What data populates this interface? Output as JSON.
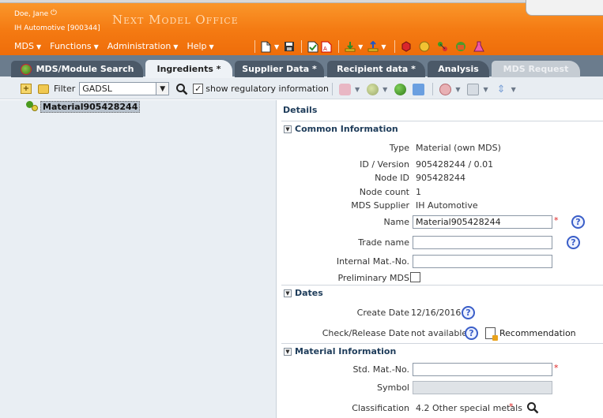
{
  "header": {
    "user_name": "Doe, Jane",
    "company": "IH Automotive [900344]",
    "app_title": "Next Model Office"
  },
  "menus": [
    {
      "label": "MDS"
    },
    {
      "label": "Functions"
    },
    {
      "label": "Administration"
    },
    {
      "label": "Help"
    }
  ],
  "tabs": [
    {
      "label": "MDS/Module Search"
    },
    {
      "label": "Ingredients *"
    },
    {
      "label": "Supplier Data *"
    },
    {
      "label": "Recipient data *"
    },
    {
      "label": "Analysis"
    },
    {
      "label": "MDS Request"
    }
  ],
  "toolbar": {
    "filter_label": "Filter",
    "filter_value": "GADSL",
    "show_regulatory_label": "show regulatory information",
    "show_regulatory_checked": true
  },
  "tree": {
    "root_label": "Material905428244"
  },
  "details": {
    "title": "Details",
    "common": {
      "section_title": "Common Information",
      "type_label": "Type",
      "type_value": "Material (own MDS)",
      "id_label": "ID / Version",
      "id_value": "905428244 / 0.01",
      "node_id_label": "Node ID",
      "node_id_value": "905428244",
      "node_count_label": "Node count",
      "node_count_value": "1",
      "supplier_label": "MDS Supplier",
      "supplier_value": "IH Automotive",
      "name_label": "Name",
      "name_value": "Material905428244",
      "trade_name_label": "Trade name",
      "trade_name_value": "",
      "internal_label": "Internal Mat.-No.",
      "internal_value": "",
      "preliminary_label": "Preliminary MDS"
    },
    "dates": {
      "section_title": "Dates",
      "create_label": "Create Date",
      "create_value": "12/16/2016",
      "check_label": "Check/Release Date",
      "check_value": "not available",
      "recommendation_label": "Recommendation"
    },
    "material": {
      "section_title": "Material Information",
      "std_label": "Std. Mat.-No.",
      "std_value": "",
      "symbol_label": "Symbol",
      "symbol_value": "",
      "classification_label": "Classification",
      "classification_value": "4.2 Other special metals"
    }
  },
  "colors": {
    "header_orange": "#f47a12",
    "tabbar": "#6b7c8d",
    "required": "#dd2222"
  }
}
